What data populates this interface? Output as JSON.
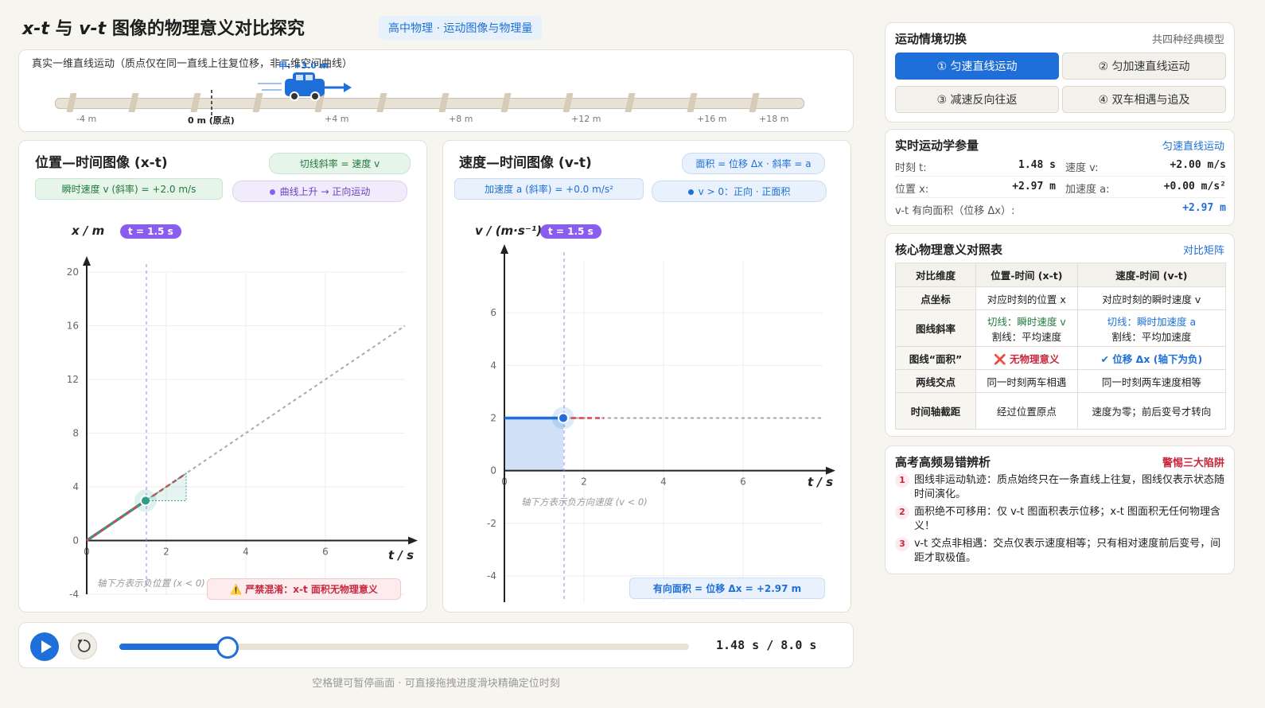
{
  "header": {
    "title_part1": "x-t",
    "title_part2": " 与 ",
    "title_part3": "v-t",
    "title_part4": " 图像的物理意义对比探究",
    "tag": "高中物理 · 运动图像与物理量"
  },
  "track": {
    "caption": "真实一维直线运动（质点仅在同一直线上往复位移，非二维空间曲线）",
    "car_label": "甲: +3.0 m",
    "ticks": [
      "-4 m",
      "0 m (原点)",
      "+4 m",
      "+8 m",
      "+12 m",
      "+16 m",
      "+18 m"
    ]
  },
  "xt": {
    "title": "位置—时间图像 (x-t)",
    "slope_pill": "切线斜率 = 速度 v",
    "velocity_pill": "瞬时速度 v (斜率) = +2.0 m/s",
    "trend_pill": "曲线上升 → 正向运动",
    "time_badge": "t = 1.5 s",
    "y_axis_label": "x / m",
    "x_axis_label": "t / s",
    "note": "轴下方表示负位置 (x < 0)",
    "warning": "⚠️ 严禁混淆：x-t 面积无物理意义"
  },
  "vt": {
    "title": "速度—时间图像 (v-t)",
    "area_pill": "面积 = 位移 Δx · 斜率 = a",
    "accel_pill": "加速度 a (斜率) = +0.0 m/s²",
    "sign_pill": "v > 0：正向 · 正面积",
    "time_badge": "t = 1.5 s",
    "y_axis_label": "v / (m·s⁻¹)",
    "x_axis_label": "t / s",
    "note": "轴下方表示负方向速度 (v < 0)",
    "area_result": "有向面积 = 位移 Δx = +2.97 m"
  },
  "chart_data": [
    {
      "type": "line",
      "title": "位置—时间图像 (x-t)",
      "xlabel": "t / s",
      "ylabel": "x / m",
      "xlim": [
        0,
        8
      ],
      "ylim": [
        -4,
        20
      ],
      "x_ticks": [
        "0",
        "2",
        "4",
        "6"
      ],
      "y_ticks": [
        "-4",
        "0",
        "4",
        "8",
        "12",
        "16",
        "20"
      ],
      "series": [
        {
          "x": [
            0,
            1.48
          ],
          "y": [
            0,
            2.97
          ]
        },
        {
          "x": [
            1.48,
            8
          ],
          "y": [
            2.97,
            16
          ]
        }
      ],
      "marker": {
        "t": 1.48,
        "x": 2.97
      },
      "tangent": {
        "x": [
          0,
          2.5
        ],
        "y": [
          0,
          5
        ]
      },
      "time_cursor": 1.5,
      "colors": {
        "traveled": "#2aa08a",
        "future": "#aaaaaa",
        "tangent": "#e0434b",
        "cursor": "#9b7de0"
      }
    },
    {
      "type": "line",
      "title": "速度—时间图像 (v-t)",
      "xlabel": "t / s",
      "ylabel": "v / (m·s⁻¹)",
      "xlim": [
        0,
        8
      ],
      "ylim": [
        -5,
        8
      ],
      "x_ticks": [
        "0",
        "2",
        "4",
        "6"
      ],
      "y_ticks": [
        "-4",
        "-2",
        "0",
        "2",
        "4",
        "6"
      ],
      "series": [
        {
          "x": [
            0,
            1.48
          ],
          "y": [
            2,
            2
          ]
        },
        {
          "x": [
            1.48,
            8
          ],
          "y": [
            2,
            2
          ]
        }
      ],
      "marker": {
        "t": 1.48,
        "v": 2.0
      },
      "tangent": {
        "x": [
          1.48,
          2.5
        ],
        "y": [
          2,
          2
        ]
      },
      "shaded_area": {
        "t_from": 0,
        "t_to": 1.48,
        "v": 2.0
      },
      "time_cursor": 1.5,
      "colors": {
        "traveled": "#1e6fd9",
        "future": "#aaaaaa",
        "tangent": "#e0434b",
        "area": "#cfe0f7",
        "cursor": "#9b7de0"
      }
    }
  ],
  "controls": {
    "time_readout": "1.48 s / 8.0 s",
    "progress": 0.185,
    "hint": "空格键可暂停画面 · 可直接拖拽进度滑块精确定位时刻"
  },
  "switch": {
    "title": "运动情境切换",
    "subtitle": "共四种经典模型",
    "buttons": [
      "① 匀速直线运动",
      "② 匀加速直线运动",
      "③ 减速反向往返",
      "④ 双车相遇与追及"
    ],
    "active_index": 0
  },
  "kinematics": {
    "title": "实时运动学参量",
    "mode": "匀速直线运动",
    "t_label": "时刻 t:",
    "t_value": "1.48 s",
    "v_label": "速度 v:",
    "v_value": "+2.00 m/s",
    "x_label": "位置 x:",
    "x_value": "+2.97 m",
    "a_label": "加速度 a:",
    "a_value": "+0.00 m/s²",
    "area_label": "v-t 有向面积（位移 Δx）:",
    "area_value": "+2.97 m"
  },
  "table": {
    "title": "核心物理意义对照表",
    "link": "对比矩阵",
    "headers": [
      "对比维度",
      "位置-时间 (x-t)",
      "速度-时间 (v-t)"
    ],
    "rows": [
      {
        "dim": "点坐标",
        "xt": "对应时刻的位置 x",
        "vt": "对应时刻的瞬时速度 v"
      },
      {
        "dim": "图线斜率",
        "xt_1": "切线：瞬时速度 v",
        "xt_2": "割线：平均速度",
        "vt_1": "切线：瞬时加速度 a",
        "vt_2": "割线：平均加速度"
      },
      {
        "dim": "图线“面积”",
        "xt": "❌ 无物理意义",
        "vt": "✔ 位移 Δx (轴下为负)"
      },
      {
        "dim": "两线交点",
        "xt": "同一时刻两车相遇",
        "vt": "同一时刻两车速度相等"
      },
      {
        "dim": "时间轴截距",
        "xt": "经过位置原点",
        "vt": "速度为零；前后变号才转向"
      }
    ]
  },
  "traps": {
    "title": "高考高频易错辨析",
    "warn": "警惕三大陷阱",
    "items": [
      {
        "num": "1",
        "text": "图线非运动轨迹：质点始终只在一条直线上往复，图线仅表示状态随时间演化。"
      },
      {
        "num": "2",
        "text": "面积绝不可移用：仅 v-t 图面积表示位移；x-t 图面积无任何物理含义！"
      },
      {
        "num": "3",
        "text": "v-t 交点非相遇：交点仅表示速度相等；只有相对速度前后变号，间距才取极值。"
      }
    ]
  },
  "colors": {
    "accent": "#1e6fd9",
    "green": "#2aa08a",
    "purple": "#8a5cf0",
    "red": "#c8283d"
  }
}
